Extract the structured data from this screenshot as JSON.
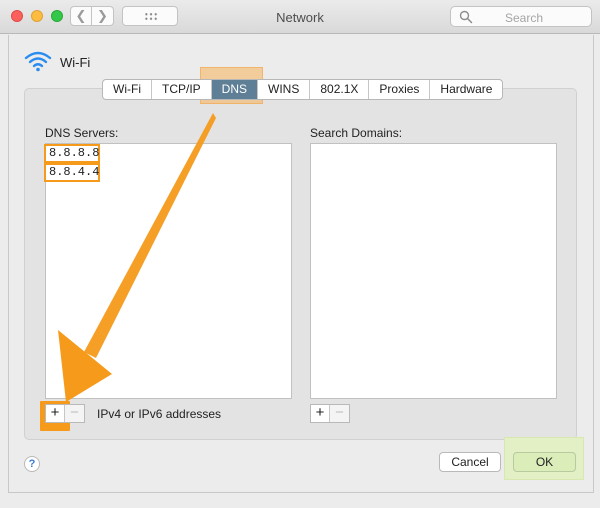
{
  "window": {
    "title": "Network",
    "search_placeholder": "Search",
    "back_glyph": "❮",
    "forward_glyph": "❯"
  },
  "service": {
    "name": "Wi-Fi",
    "icon": "wifi-icon"
  },
  "tabs": [
    {
      "label": "Wi-Fi",
      "active": false
    },
    {
      "label": "TCP/IP",
      "active": false
    },
    {
      "label": "DNS",
      "active": true
    },
    {
      "label": "WINS",
      "active": false
    },
    {
      "label": "802.1X",
      "active": false
    },
    {
      "label": "Proxies",
      "active": false
    },
    {
      "label": "Hardware",
      "active": false
    }
  ],
  "dns": {
    "label": "DNS Servers:",
    "servers": [
      "8.8.8.8",
      "8.8.4.4"
    ],
    "hint": "IPv4 or IPv6 addresses",
    "add_glyph": "+",
    "remove_glyph": "−"
  },
  "search_domains": {
    "label": "Search Domains:",
    "items": [],
    "add_glyph": "+",
    "remove_glyph": "−"
  },
  "buttons": {
    "help": "?",
    "cancel": "Cancel",
    "ok": "OK"
  },
  "colors": {
    "highlight": "#f59a1a",
    "active_tab": "#5e7f96",
    "ok_highlight": "#e3f0c5"
  }
}
